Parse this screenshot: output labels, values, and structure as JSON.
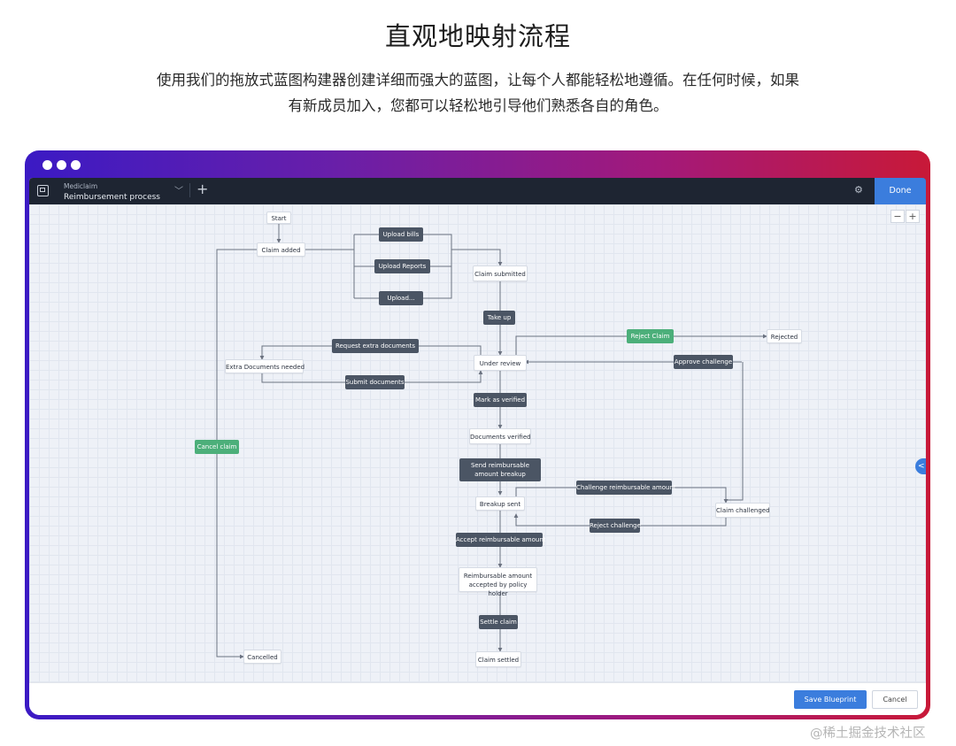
{
  "page": {
    "title": "直观地映射流程",
    "description_line1": "使用我们的拖放式蓝图构建器创建详细而强大的蓝图，让每个人都能轻松地遵循。在任何时候，如果",
    "description_line2": "有新成员加入，您都可以轻松地引导他们熟悉各自的角色。"
  },
  "app": {
    "module": "Mediclaim",
    "process": "Reimbursement process",
    "done_label": "Done",
    "zoom_out": "−",
    "zoom_in": "+",
    "side_tab": "<",
    "accent_color": "#3b7ddd",
    "transition_color": "#4b5564",
    "green_color": "#4caf7a"
  },
  "blueprint": {
    "states": {
      "start": "Start",
      "claim_added": "Claim added",
      "claim_submitted": "Claim submitted",
      "under_review": "Under review",
      "extra_docs_needed": "Extra Documents needed",
      "rejected": "Rejected",
      "documents_verified": "Documents verified",
      "breakup_sent": "Breakup sent",
      "claim_challenged": "Claim challenged",
      "reimbursable_accepted": "Reimbursable amount accepted by policy holder",
      "claim_settled": "Claim settled",
      "cancelled": "Cancelled"
    },
    "transitions": {
      "upload_bills": "Upload bills",
      "upload_reports": "Upload Reports",
      "upload_other": "Upload...",
      "take_up": "Take up",
      "reject_claim": "Reject Claim",
      "request_extra_documents": "Request extra documents",
      "submit_documents": "Submit documents",
      "approve_challenge": "Approve challenge",
      "mark_as_verified": "Mark as verified",
      "send_reimbursable_breakup": "Send reimbursable amount breakup",
      "challenge_reimbursable_amount": "Challenge reimbursable amount",
      "reject_challenge": "Reject challenge",
      "accept_reimbursable_amount": "Accept reimbursable amount",
      "settle_claim": "Settle claim",
      "cancel_claim": "Cancel claim"
    }
  },
  "footer": {
    "save_label": "Save Blueprint",
    "cancel_label": "Cancel"
  },
  "watermark": "@稀土掘金技术社区"
}
